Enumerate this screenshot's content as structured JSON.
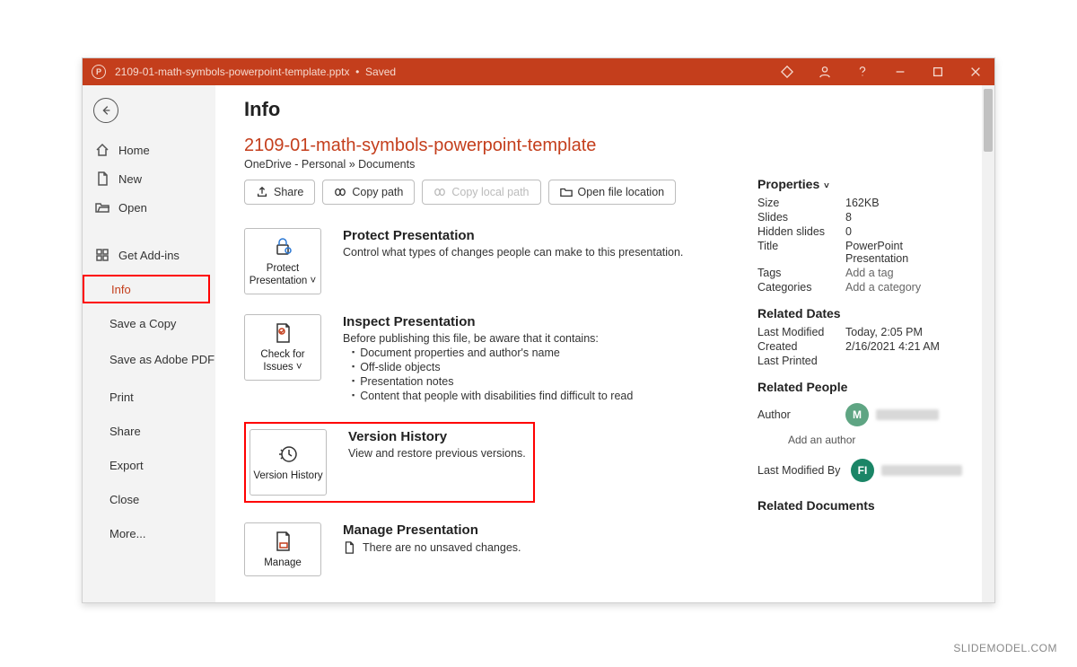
{
  "titlebar": {
    "filename": "2109-01-math-symbols-powerpoint-template.pptx",
    "status": "Saved"
  },
  "sidebar": {
    "home": "Home",
    "new": "New",
    "open": "Open",
    "addins": "Get Add-ins",
    "info": "Info",
    "saveCopy": "Save a Copy",
    "savePdf": "Save as Adobe PDF",
    "print": "Print",
    "share": "Share",
    "export": "Export",
    "close": "Close",
    "more": "More..."
  },
  "page": {
    "title": "Info",
    "docTitle": "2109-01-math-symbols-powerpoint-template",
    "docPath": "OneDrive - Personal » Documents",
    "buttons": {
      "share": "Share",
      "copyPath": "Copy path",
      "copyLocal": "Copy local path",
      "openLoc": "Open file location"
    }
  },
  "tiles": {
    "protect": {
      "label": "Protect Presentation ˅",
      "heading": "Protect Presentation",
      "desc": "Control what types of changes people can make to this presentation."
    },
    "inspect": {
      "label": "Check for Issues ˅",
      "heading": "Inspect Presentation",
      "lead": "Before publishing this file, be aware that it contains:",
      "items": [
        "Document properties and author's name",
        "Off-slide objects",
        "Presentation notes",
        "Content that people with disabilities find difficult to read"
      ]
    },
    "version": {
      "label": "Version History",
      "heading": "Version History",
      "desc": "View and restore previous versions."
    },
    "manage": {
      "label": "Manage",
      "heading": "Manage Presentation",
      "desc": "There are no unsaved changes."
    }
  },
  "props": {
    "hdr": "Properties",
    "rows": {
      "Size": "162KB",
      "Slides": "8",
      "Hidden slides": "0",
      "Title": "PowerPoint Presentation",
      "Tags": "Add a tag",
      "Categories": "Add a category"
    },
    "datesHdr": "Related Dates",
    "dates": {
      "Last Modified": "Today, 2:05 PM",
      "Created": "2/16/2021 4:21 AM",
      "Last Printed": ""
    },
    "peopleHdr": "Related People",
    "author": "Author",
    "addAuthor": "Add an author",
    "lmb": "Last Modified By",
    "docsHdr": "Related Documents"
  },
  "watermark": "SLIDEMODEL.COM"
}
